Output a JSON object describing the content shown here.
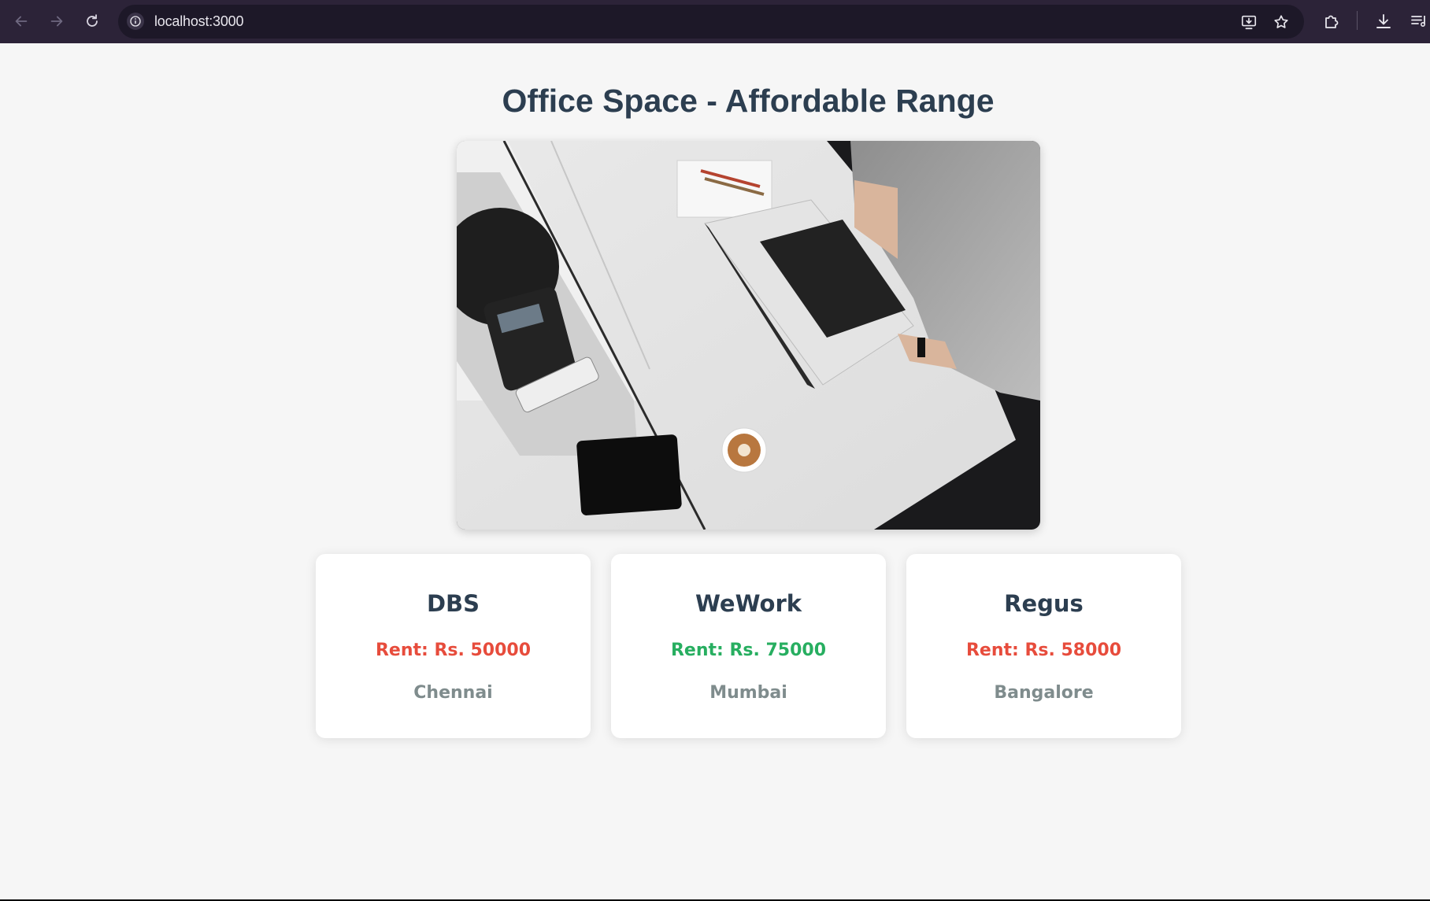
{
  "browser": {
    "url": "localhost:3000",
    "icons": {
      "back": "arrow-left-icon",
      "forward": "arrow-right-icon",
      "reload": "reload-icon",
      "site_info": "info-icon",
      "install": "install-app-icon",
      "bookmark": "star-icon",
      "extensions": "puzzle-icon",
      "downloads": "download-icon",
      "media": "media-playlist-icon"
    }
  },
  "page": {
    "title": "Office Space - Affordable Range"
  },
  "offices": [
    {
      "name": "DBS",
      "rent_label": "Rent: Rs. 50000",
      "rent_color": "#e74c3c",
      "city": "Chennai"
    },
    {
      "name": "WeWork",
      "rent_label": "Rent: Rs. 75000",
      "rent_color": "#27ae60",
      "city": "Mumbai"
    },
    {
      "name": "Regus",
      "rent_label": "Rent: Rs. 58000",
      "rent_color": "#e74c3c",
      "city": "Bangalore"
    }
  ],
  "colors": {
    "title": "#2c3e50",
    "city": "#7f8c8d",
    "chrome_bg": "#2c2338",
    "page_bg": "#f6f6f6"
  }
}
